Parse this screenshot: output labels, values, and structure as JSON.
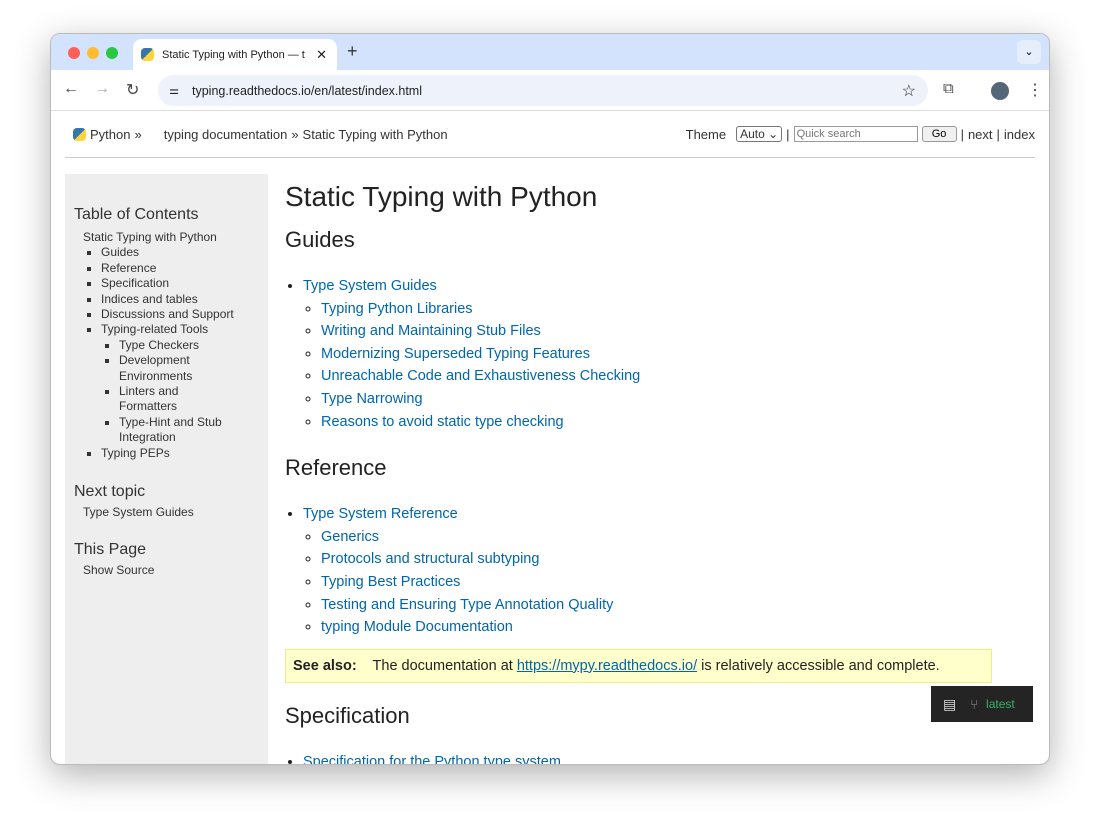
{
  "browser": {
    "tab_title": "Static Typing with Python — t",
    "url": "typing.readthedocs.io/en/latest/index.html"
  },
  "related": {
    "python": "Python",
    "sep": "»",
    "docs": "typing documentation",
    "current": "Static Typing with Python",
    "theme_label": "Theme",
    "theme_value": "Auto",
    "search_placeholder": "Quick search",
    "go": "Go",
    "pipe": "|",
    "next": "next",
    "index": "index"
  },
  "sidebar": {
    "toc_title": "Table of Contents",
    "toc_root": "Static Typing with Python",
    "toc": [
      "Guides",
      "Reference",
      "Specification",
      "Indices and tables",
      "Discussions and Support",
      "Typing-related Tools"
    ],
    "tools": [
      "Type Checkers",
      "Development Environments",
      "Linters and Formatters",
      "Type-Hint and Stub Integration"
    ],
    "toc_last": "Typing PEPs",
    "next_title": "Next topic",
    "next_link": "Type System Guides",
    "page_title": "This Page",
    "show_source": "Show Source"
  },
  "main": {
    "title": "Static Typing with Python",
    "guides_h": "Guides",
    "guides_top": "Type System Guides",
    "guides": [
      "Typing Python Libraries",
      "Writing and Maintaining Stub Files",
      "Modernizing Superseded Typing Features",
      "Unreachable Code and Exhaustiveness Checking",
      "Type Narrowing",
      "Reasons to avoid static type checking"
    ],
    "ref_h": "Reference",
    "ref_top": "Type System Reference",
    "ref": [
      "Generics",
      "Protocols and structural subtyping",
      "Typing Best Practices",
      "Testing and Ensuring Type Annotation Quality",
      "typing Module Documentation"
    ],
    "seealso_label": "See also:",
    "seealso_pre": "The documentation at",
    "seealso_link": "https://mypy.readthedocs.io/",
    "seealso_post": "is relatively accessible and complete.",
    "spec_h": "Specification",
    "spec_top": "Specification for the Python type system"
  },
  "rtd": {
    "version": "latest"
  }
}
